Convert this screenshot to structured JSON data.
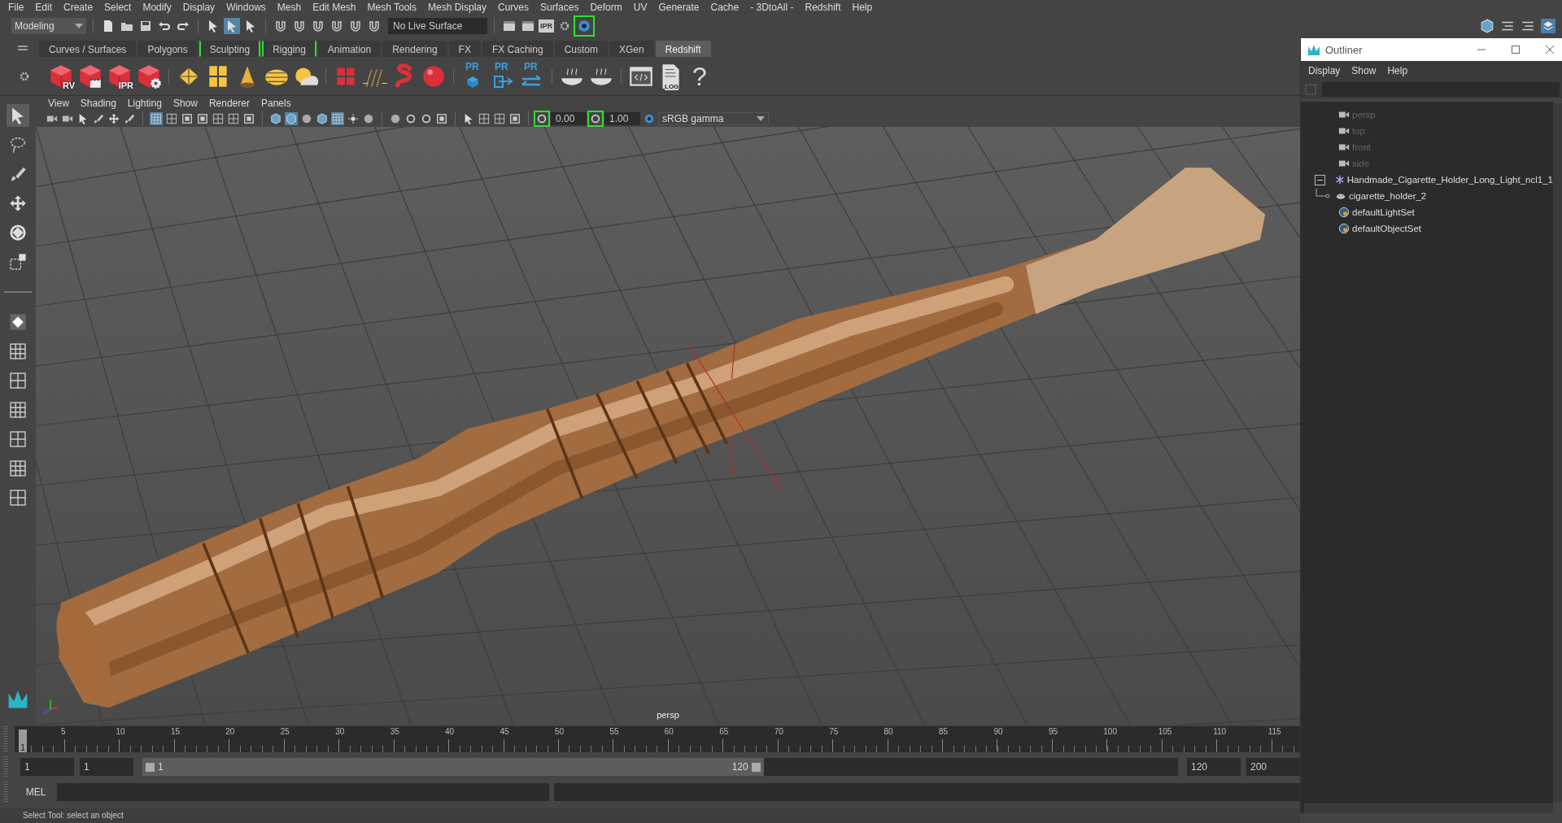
{
  "menu_bar": [
    "File",
    "Edit",
    "Create",
    "Select",
    "Modify",
    "Display",
    "Windows",
    "Mesh",
    "Edit Mesh",
    "Mesh Tools",
    "Mesh Display",
    "Curves",
    "Surfaces",
    "Deform",
    "UV",
    "Generate",
    "Cache",
    "- 3DtoAll -",
    "Redshift",
    "Help"
  ],
  "status_line": {
    "workspace": "Modeling",
    "live_surface": "No Live Surface",
    "ipr_label": "IPR"
  },
  "shelf_tabs": [
    {
      "label": "Curves / Surfaces",
      "selected": false,
      "bracketed": false
    },
    {
      "label": "Polygons",
      "selected": false,
      "bracketed": false
    },
    {
      "label": "Sculpting",
      "selected": false,
      "bracketed": true
    },
    {
      "label": "Rigging",
      "selected": false,
      "bracketed": true
    },
    {
      "label": "Animation",
      "selected": false,
      "bracketed": false
    },
    {
      "label": "Rendering",
      "selected": false,
      "bracketed": false
    },
    {
      "label": "FX",
      "selected": false,
      "bracketed": false
    },
    {
      "label": "FX Caching",
      "selected": false,
      "bracketed": false
    },
    {
      "label": "Custom",
      "selected": false,
      "bracketed": false
    },
    {
      "label": "XGen",
      "selected": false,
      "bracketed": false
    },
    {
      "label": "Redshift",
      "selected": true,
      "bracketed": false
    }
  ],
  "shelf_buttons": [
    {
      "kind": "rs-cube",
      "label": "RV"
    },
    {
      "kind": "rs-clapper"
    },
    {
      "kind": "rs-cube",
      "label": "IPR"
    },
    {
      "kind": "rs-gear"
    },
    {
      "kind": "diamond"
    },
    {
      "kind": "panels"
    },
    {
      "kind": "cone"
    },
    {
      "kind": "dome"
    },
    {
      "kind": "sun"
    },
    {
      "kind": "cubes"
    },
    {
      "kind": "strokes"
    },
    {
      "kind": "snake"
    },
    {
      "kind": "sphere"
    },
    {
      "kind": "pr-cube",
      "label": "PR"
    },
    {
      "kind": "pr-export",
      "label": "PR"
    },
    {
      "kind": "pr-swap",
      "label": "PR"
    },
    {
      "kind": "bowl"
    },
    {
      "kind": "bowl"
    },
    {
      "kind": "script"
    },
    {
      "kind": "log",
      "label": "LOG"
    },
    {
      "kind": "help",
      "label": "?"
    }
  ],
  "panel_menu": [
    "View",
    "Shading",
    "Lighting",
    "Show",
    "Renderer",
    "Panels"
  ],
  "panel_toolbar": {
    "exposure": "0.00",
    "gamma": "1.00",
    "view_transform": "sRGB gamma"
  },
  "viewport": {
    "camera_label": "persp"
  },
  "outliner": {
    "title": "Outliner",
    "menu": [
      "Display",
      "Show",
      "Help"
    ],
    "items": [
      {
        "label": "persp",
        "kind": "camera",
        "dimmed": true
      },
      {
        "label": "top",
        "kind": "camera",
        "dimmed": true
      },
      {
        "label": "front",
        "kind": "camera",
        "dimmed": true
      },
      {
        "label": "side",
        "kind": "camera",
        "dimmed": true
      },
      {
        "label": "Handmade_Cigarette_Holder_Long_Light_ncl1_1",
        "kind": "group",
        "dimmed": false,
        "expanded": true,
        "children": [
          {
            "label": "cigarette_holder_2",
            "kind": "mesh",
            "dimmed": false
          }
        ]
      },
      {
        "label": "defaultLightSet",
        "kind": "set",
        "dimmed": false
      },
      {
        "label": "defaultObjectSet",
        "kind": "set",
        "dimmed": false
      }
    ]
  },
  "time_slider": {
    "ticks": [
      "5",
      "10",
      "15",
      "20",
      "25",
      "30",
      "35",
      "40",
      "45",
      "50",
      "55",
      "60",
      "65",
      "70",
      "75",
      "80",
      "85",
      "90",
      "95",
      "100",
      "105",
      "110",
      "115"
    ],
    "current_frame": "1",
    "level": 0
  },
  "range_slider": {
    "start": "1",
    "playback_start": "1",
    "range_start": "1",
    "range_end": "120",
    "playback_end": "120",
    "end": "200",
    "level": 0.6
  },
  "command_line": {
    "label": "MEL"
  },
  "help_line": "Select Tool: select an object"
}
